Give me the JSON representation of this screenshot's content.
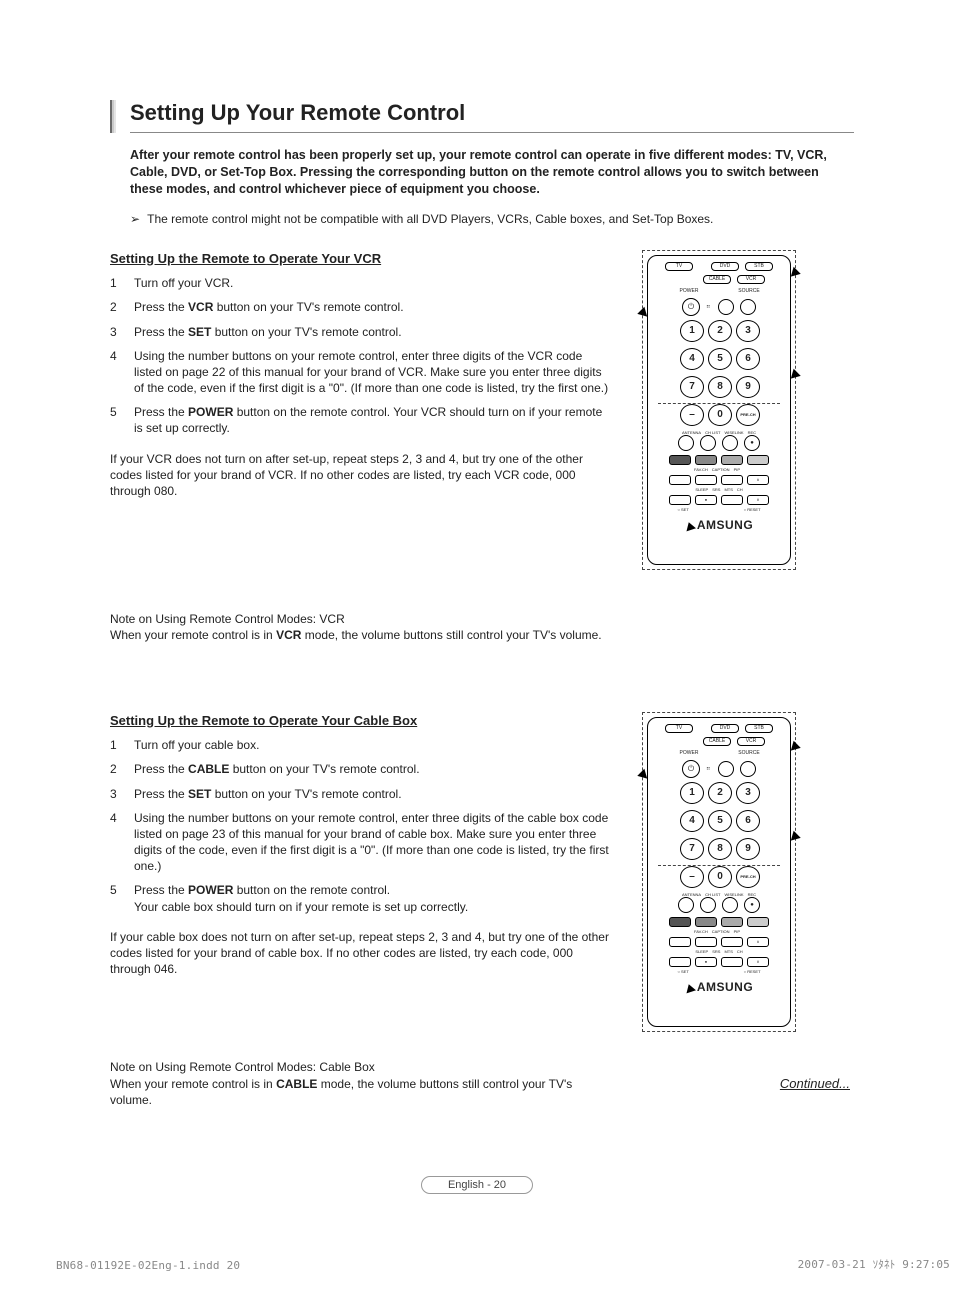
{
  "title": "Setting Up Your Remote Control",
  "intro": "After your remote control has been properly set up, your remote control can operate in five different modes: TV, VCR, Cable, DVD, or Set-Top Box. Pressing the corresponding button on the remote control allows you to switch between these modes, and control whichever piece of equipment you choose.",
  "compat_note": "The remote control might not be compatible with all DVD Players, VCRs, Cable boxes, and Set-Top Boxes.",
  "vcr": {
    "heading": "Setting Up the Remote to Operate Your VCR",
    "steps": {
      "s1": "Turn off your VCR.",
      "s2_a": "Press the ",
      "s2_b": "VCR",
      "s2_c": " button on your TV's remote control.",
      "s3_a": "Press the ",
      "s3_b": "SET",
      "s3_c": " button on your TV's remote control.",
      "s4": "Using the number buttons on your remote control, enter three digits of the VCR code listed on page 22 of this manual for your brand of VCR. Make sure you enter three digits of the code, even if the first digit is a \"0\". (If more than one code is listed, try the first one.)",
      "s5_a": "Press the ",
      "s5_b": "POWER",
      "s5_c": " button on the remote control. Your VCR should turn on if your remote is set up correctly."
    },
    "fallback": "If your VCR does not turn on after set-up, repeat steps 2, 3 and 4, but try one of the other codes listed for your brand of VCR. If no other codes are listed, try each VCR code, 000 through 080.",
    "mode_note_a": "Note on Using Remote Control Modes: VCR",
    "mode_note_b1": "When your remote control is in ",
    "mode_note_b2": "VCR",
    "mode_note_b3": " mode, the volume buttons still control your TV's volume."
  },
  "cable": {
    "heading": "Setting Up the Remote to Operate Your Cable Box",
    "steps": {
      "s1": "Turn off your cable box.",
      "s2_a": "Press the ",
      "s2_b": "CABLE",
      "s2_c": " button on your TV's remote control.",
      "s3_a": "Press the ",
      "s3_b": "SET",
      "s3_c": " button on your TV's remote control.",
      "s4": "Using the number buttons on your remote control, enter three digits of the cable box code listed on page 23 of this manual for your brand of cable box. Make sure you enter three digits of the code, even if the first digit is a \"0\". (If more than one code is listed, try the first one.)",
      "s5_a": "Press the ",
      "s5_b": "POWER",
      "s5_c": " button on the remote control.\nYour cable box should turn on if your remote is set up correctly."
    },
    "fallback": "If your cable box does not turn on after set-up, repeat steps 2, 3 and 4, but try one of the other codes listed for your brand of cable box. If no other codes are listed, try each code, 000 through 046.",
    "mode_note_a": "Note on Using Remote Control Modes: Cable Box",
    "mode_note_b1": "When your remote control is in ",
    "mode_note_b2": "CABLE",
    "mode_note_b3": " mode, the volume buttons still control your TV's volume."
  },
  "remote": {
    "btn_tv": "TV",
    "btn_dvd": "DVD",
    "btn_stb": "STB",
    "btn_cable": "CABLE",
    "btn_vcr": "VCR",
    "lbl_power": "POWER",
    "lbl_source": "SOURCE",
    "lbl_antenna": "ANTENNA",
    "lbl_chlist": "CH LIST",
    "lbl_wiselink": "WISELINK",
    "lbl_rec": "REC",
    "lbl_prech": "PRE-CH",
    "brand": "AMSUNG",
    "lbl_favch": "FAV.CH",
    "lbl_caption": "CAPTION",
    "lbl_pip": "PIP",
    "lbl_sleep": "SLEEP",
    "lbl_srs": "SRS",
    "lbl_mts": "MTS",
    "lbl_ch": "CH",
    "lbl_set": "SET",
    "lbl_reset": "RESET",
    "num_1": "1",
    "num_2": "2",
    "num_3": "3",
    "num_4": "4",
    "num_5": "5",
    "num_6": "6",
    "num_7": "7",
    "num_8": "8",
    "num_9": "9",
    "num_0": "0",
    "num_dash": "–"
  },
  "continued": "Continued...",
  "page_badge": "English - 20",
  "meta_left": "BN68-01192E-02Eng-1.indd   20",
  "meta_right": "2007-03-21   ｿﾀﾈﾄ 9:27:05"
}
